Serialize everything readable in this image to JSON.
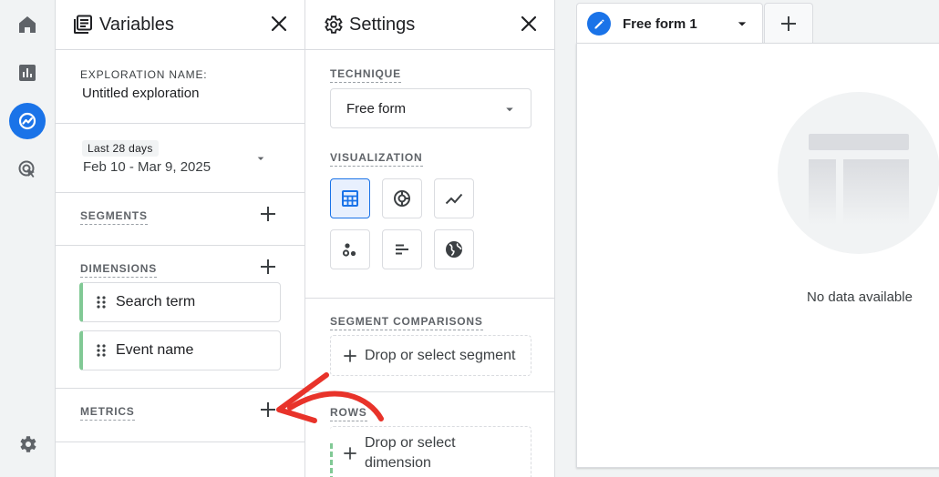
{
  "nav": {
    "items": [
      {
        "icon": "home-icon"
      },
      {
        "icon": "reports-icon"
      },
      {
        "icon": "explore-icon",
        "active": true
      },
      {
        "icon": "advertising-icon"
      }
    ],
    "settings_icon": "gear-icon",
    "accent_color": "#1a73e8"
  },
  "variables": {
    "title": "Variables",
    "exploration_name_label": "EXPLORATION NAME:",
    "exploration_name": "Untitled exploration",
    "date_chip": "Last 28 days",
    "date_range": "Feb 10 - Mar 9, 2025",
    "segments_label": "SEGMENTS",
    "dimensions_label": "DIMENSIONS",
    "dimensions": [
      "Search term",
      "Event name"
    ],
    "dimension_color": "#81c995",
    "metrics_label": "METRICS"
  },
  "settings": {
    "title": "Settings",
    "technique_label": "TECHNIQUE",
    "technique_value": "Free form",
    "visualization_label": "VISUALIZATION",
    "visualizations": [
      "table-icon",
      "donut-chart-icon",
      "line-chart-icon",
      "scatter-plot-icon",
      "bar-chart-icon",
      "geo-map-icon"
    ],
    "segment_comparisons_label": "SEGMENT COMPARISONS",
    "segment_drop_label": "Drop or select segment",
    "rows_label": "ROWS",
    "rows_drop_label": "Drop or select dimension"
  },
  "canvas": {
    "tab_label": "Free form 1",
    "empty_message": "No data available"
  },
  "annotation": {
    "arrow_color": "#e8332a"
  }
}
